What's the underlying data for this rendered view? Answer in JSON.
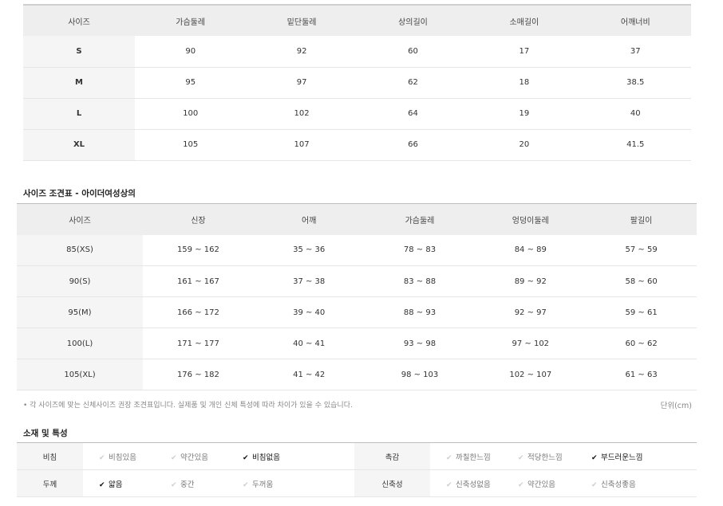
{
  "size_table": {
    "headers": [
      "사이즈",
      "가슴둘레",
      "밑단둘레",
      "상의길이",
      "소매길이",
      "어깨너비"
    ],
    "rows": [
      [
        "S",
        "90",
        "92",
        "60",
        "17",
        "37"
      ],
      [
        "M",
        "95",
        "97",
        "62",
        "18",
        "38.5"
      ],
      [
        "L",
        "100",
        "102",
        "64",
        "19",
        "40"
      ],
      [
        "XL",
        "105",
        "107",
        "66",
        "20",
        "41.5"
      ]
    ]
  },
  "body_table": {
    "title": "사이즈 조견표 - 아이더여성상의",
    "headers": [
      "사이즈",
      "신장",
      "어깨",
      "가슴둘레",
      "엉덩이둘레",
      "팔길이"
    ],
    "rows": [
      [
        "85(XS)",
        "159 ~ 162",
        "35 ~ 36",
        "78 ~ 83",
        "84 ~ 89",
        "57 ~ 59"
      ],
      [
        "90(S)",
        "161 ~ 167",
        "37 ~ 38",
        "83 ~ 88",
        "89 ~ 92",
        "58 ~ 60"
      ],
      [
        "95(M)",
        "166 ~ 172",
        "39 ~ 40",
        "88 ~ 93",
        "92 ~ 97",
        "59 ~ 61"
      ],
      [
        "100(L)",
        "171 ~ 177",
        "40 ~ 41",
        "93 ~ 98",
        "97 ~ 102",
        "60 ~ 62"
      ],
      [
        "105(XL)",
        "176 ~ 182",
        "41 ~ 42",
        "98 ~ 103",
        "102 ~ 107",
        "61 ~ 63"
      ]
    ],
    "note": "• 각 사이즈에 맞는 신체사이즈 권장 조견표입니다. 실제품 및 개인 신체 특성에 따라 차이가 있을 수 있습니다.",
    "unit": "단위(cm)"
  },
  "material": {
    "title": "소재 및 특성",
    "rows": [
      {
        "left_label": "비침",
        "left_options": [
          {
            "text": "비침있음",
            "selected": false
          },
          {
            "text": "약간있음",
            "selected": false
          },
          {
            "text": "비침없음",
            "selected": true
          }
        ],
        "right_label": "촉감",
        "right_options": [
          {
            "text": "까칠한느낌",
            "selected": false
          },
          {
            "text": "적당한느낌",
            "selected": false
          },
          {
            "text": "부드러운느낌",
            "selected": true
          }
        ]
      },
      {
        "left_label": "두께",
        "left_options": [
          {
            "text": "얇음",
            "selected": true
          },
          {
            "text": "중간",
            "selected": false
          },
          {
            "text": "두꺼움",
            "selected": false
          }
        ],
        "right_label": "신축성",
        "right_options": [
          {
            "text": "신축성없음",
            "selected": false
          },
          {
            "text": "약간있음",
            "selected": false
          },
          {
            "text": "신축성좋음",
            "selected": false
          }
        ]
      }
    ],
    "check_glyph": "✔"
  }
}
